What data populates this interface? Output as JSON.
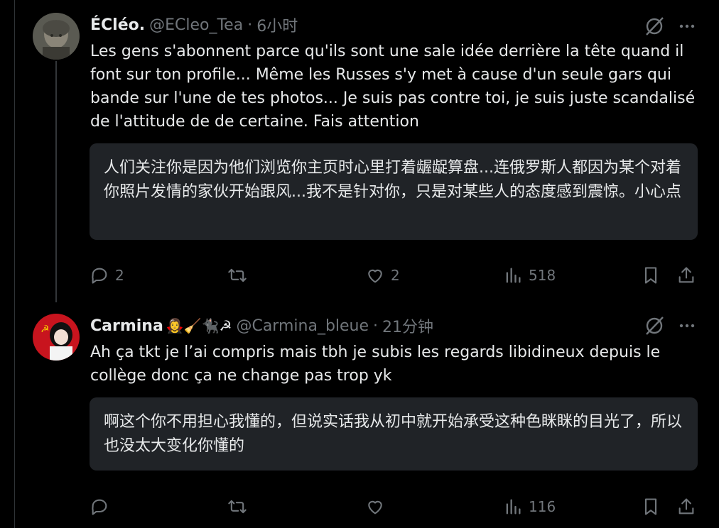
{
  "tweets": [
    {
      "name": "ÉCléo.",
      "handle": "@ECleo_Tea",
      "separator": "·",
      "time": "6小时",
      "body": "Les gens s'abonnent parce qu'ils sont une sale idée derrière la tête quand il font sur ton profile... Même les Russes s'y met à cause d'un seule gars qui bande sur l'une de tes photos... Je suis pas contre toi, je suis juste scandalisé de l'attitude de de certaine. Fais attention",
      "translation": "人们关注你是因为他们浏览你主页时心里打着龌龊算盘...连俄罗斯人都因为某个对着你照片发情的家伙开始跟风...我不是针对你，只是对某些人的态度感到震惊。小心点",
      "replies": "2",
      "retweets": "",
      "likes": "2",
      "views": "518"
    },
    {
      "name": "Carmina",
      "emojis": "🧛‍♀️🧹🐈‍⬛☭",
      "handle": "@Carmina_bleue",
      "separator": "·",
      "time": "21分钟",
      "body": "Ah ça tkt je l’ai compris mais tbh je subis les regards libidineux depuis le collège donc ça ne change pas trop yk",
      "translation": "啊这个你不用担心我懂的，但说实话我从初中就开始承受这种色眯眯的目光了，所以也没太大变化你懂的",
      "replies": "",
      "retweets": "",
      "likes": "",
      "views": "116"
    }
  ],
  "icons": [
    "grok-icon",
    "more-icon",
    "reply-icon",
    "retweet-icon",
    "like-icon",
    "views-icon",
    "bookmark-icon",
    "share-icon"
  ],
  "colors": {
    "background": "#000000",
    "text": "#e7e9ea",
    "muted": "#71767b",
    "translation_bg": "#202327"
  }
}
